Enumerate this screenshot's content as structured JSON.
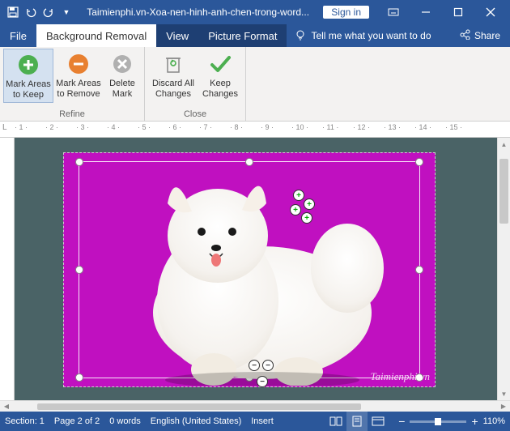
{
  "titlebar": {
    "title": "Taimienphi.vn-Xoa-nen-hinh-anh-chen-trong-word...",
    "signin": "Sign in"
  },
  "tabs": {
    "file": "File",
    "bgremoval": "Background Removal",
    "view": "View",
    "picformat": "Picture Format",
    "tellme": "Tell me what you want to do",
    "share": "Share"
  },
  "ribbon": {
    "refine": {
      "label": "Refine",
      "mark_keep": "Mark Areas to Keep",
      "mark_remove": "Mark Areas to Remove",
      "delete_mark": "Delete Mark"
    },
    "close": {
      "label": "Close",
      "discard": "Discard All Changes",
      "keep": "Keep Changes"
    }
  },
  "ruler_numbers": [
    "1",
    "2",
    "3",
    "4",
    "5",
    "6",
    "7",
    "8",
    "9",
    "10",
    "11",
    "12",
    "13",
    "14",
    "15"
  ],
  "canvas": {
    "watermark": "Taimienphi.vn"
  },
  "status": {
    "section": "Section: 1",
    "page": "Page 2 of 2",
    "words": "0 words",
    "language": "English (United States)",
    "mode": "Insert",
    "zoom_minus": "−",
    "zoom_plus": "+",
    "zoom": "110%"
  }
}
